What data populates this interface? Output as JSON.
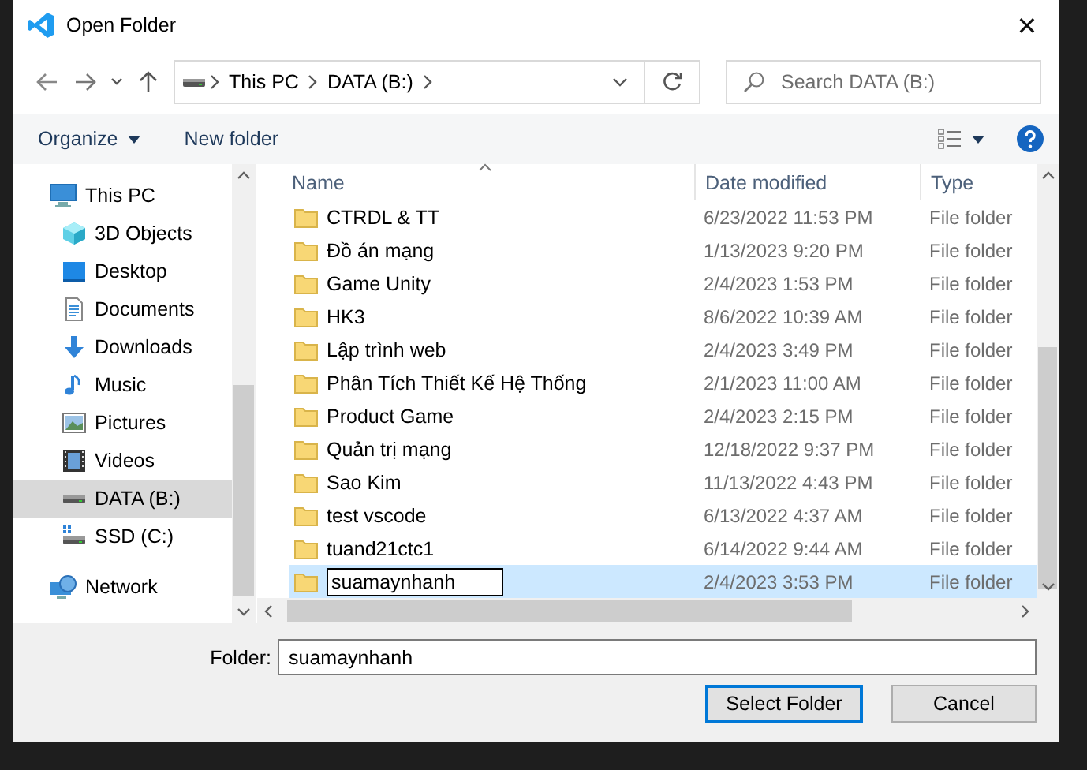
{
  "window": {
    "title": "Open Folder",
    "close": "✕"
  },
  "navigation": {
    "address": [
      "This PC",
      "DATA (B:)"
    ],
    "search": {
      "placeholder": "Search DATA (B:)"
    }
  },
  "toolbar": {
    "organize": "Organize",
    "new_folder": "New folder"
  },
  "sidebar": {
    "items": [
      {
        "label": "This PC",
        "kind": "pc",
        "selected": false,
        "children": [
          {
            "label": "3D Objects",
            "kind": "objects",
            "selected": false
          },
          {
            "label": "Desktop",
            "kind": "desktop",
            "selected": false
          },
          {
            "label": "Documents",
            "kind": "documents",
            "selected": false
          },
          {
            "label": "Downloads",
            "kind": "downloads",
            "selected": false
          },
          {
            "label": "Music",
            "kind": "music",
            "selected": false
          },
          {
            "label": "Pictures",
            "kind": "pictures",
            "selected": false
          },
          {
            "label": "Videos",
            "kind": "videos",
            "selected": false
          },
          {
            "label": "DATA (B:)",
            "kind": "drive",
            "selected": true
          },
          {
            "label": "SSD (C:)",
            "kind": "ssd",
            "selected": false
          }
        ]
      },
      {
        "label": "Network",
        "kind": "network",
        "selected": false
      }
    ]
  },
  "table": {
    "columns": [
      "Name",
      "Date modified",
      "Type"
    ],
    "rows": [
      {
        "name": "CTRDL & TT",
        "date": "6/23/2022 11:53 PM",
        "type": "File folder",
        "selected": false,
        "editing": false
      },
      {
        "name": "Đồ án mạng",
        "date": "1/13/2023 9:20 PM",
        "type": "File folder",
        "selected": false,
        "editing": false
      },
      {
        "name": "Game Unity",
        "date": "2/4/2023 1:53 PM",
        "type": "File folder",
        "selected": false,
        "editing": false
      },
      {
        "name": "HK3",
        "date": "8/6/2022 10:39 AM",
        "type": "File folder",
        "selected": false,
        "editing": false
      },
      {
        "name": "Lập trình web",
        "date": "2/4/2023 3:49 PM",
        "type": "File folder",
        "selected": false,
        "editing": false
      },
      {
        "name": "Phân Tích Thiết Kế Hệ Thống",
        "date": "2/1/2023 11:00 AM",
        "type": "File folder",
        "selected": false,
        "editing": false
      },
      {
        "name": "Product Game",
        "date": "2/4/2023 2:15 PM",
        "type": "File folder",
        "selected": false,
        "editing": false
      },
      {
        "name": "Quản trị mạng",
        "date": "12/18/2022 9:37 PM",
        "type": "File folder",
        "selected": false,
        "editing": false
      },
      {
        "name": "Sao Kim",
        "date": "11/13/2022 4:43 PM",
        "type": "File folder",
        "selected": false,
        "editing": false
      },
      {
        "name": "test vscode",
        "date": "6/13/2022 4:37 AM",
        "type": "File folder",
        "selected": false,
        "editing": false
      },
      {
        "name": "tuand21ctc1",
        "date": "6/14/2022 9:44 AM",
        "type": "File folder",
        "selected": false,
        "editing": false
      },
      {
        "name": "suamaynhanh",
        "date": "2/4/2023 3:53 PM",
        "type": "File folder",
        "selected": true,
        "editing": true
      }
    ]
  },
  "folder_field": {
    "label": "Folder:",
    "value": "suamaynhanh"
  },
  "buttons": [
    {
      "label": "Select Folder",
      "default": true
    },
    {
      "label": "Cancel",
      "default": false
    }
  ]
}
